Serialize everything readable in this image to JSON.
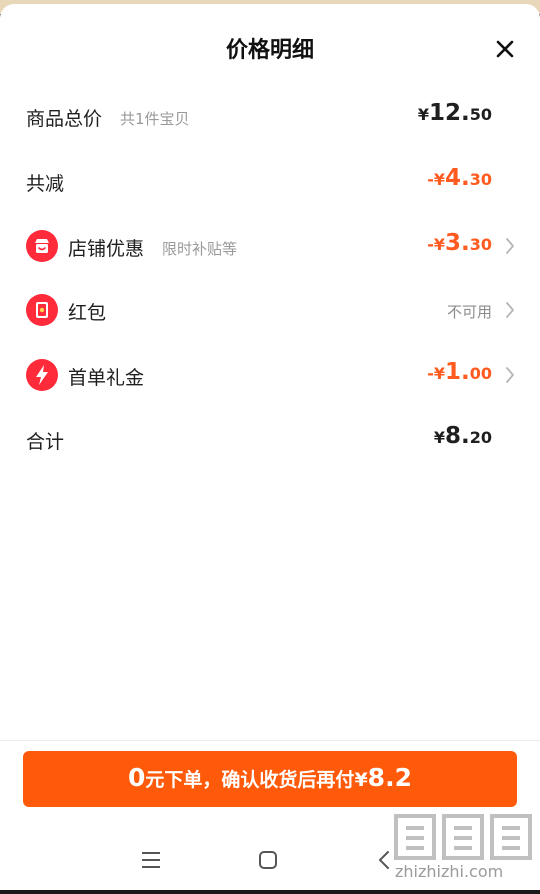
{
  "sheet": {
    "title": "价格明细"
  },
  "rows": {
    "total": {
      "label": "商品总价",
      "sub": "共1件宝贝",
      "price": {
        "sym": "¥",
        "int": "12.",
        "dec": "50"
      }
    },
    "reduce": {
      "label": "共减",
      "price": {
        "sym": "-¥",
        "int": "4.",
        "dec": "30"
      }
    },
    "shop": {
      "label": "店铺优惠",
      "sub": "限时补贴等",
      "icon": "shop-icon",
      "price": {
        "sym": "-¥",
        "int": "3.",
        "dec": "30"
      }
    },
    "redpacket": {
      "label": "红包",
      "icon": "red-packet-icon",
      "status": "不可用"
    },
    "first": {
      "label": "首单礼金",
      "icon": "lightning-icon",
      "price": {
        "sym": "-¥",
        "int": "1.",
        "dec": "00"
      }
    },
    "sum": {
      "label": "合计",
      "price": {
        "sym": "¥",
        "int": "8.",
        "dec": "20"
      }
    }
  },
  "cta": {
    "zero": "0",
    "text": "元下单，确认收货后再付",
    "sym": "¥",
    "amount": "8.2"
  },
  "watermark": {
    "text": "zhizhizhi.com"
  },
  "colors": {
    "accent": "#ff5a1f",
    "button": "#ff5a0a",
    "icon_red": "#ff2a3a"
  }
}
